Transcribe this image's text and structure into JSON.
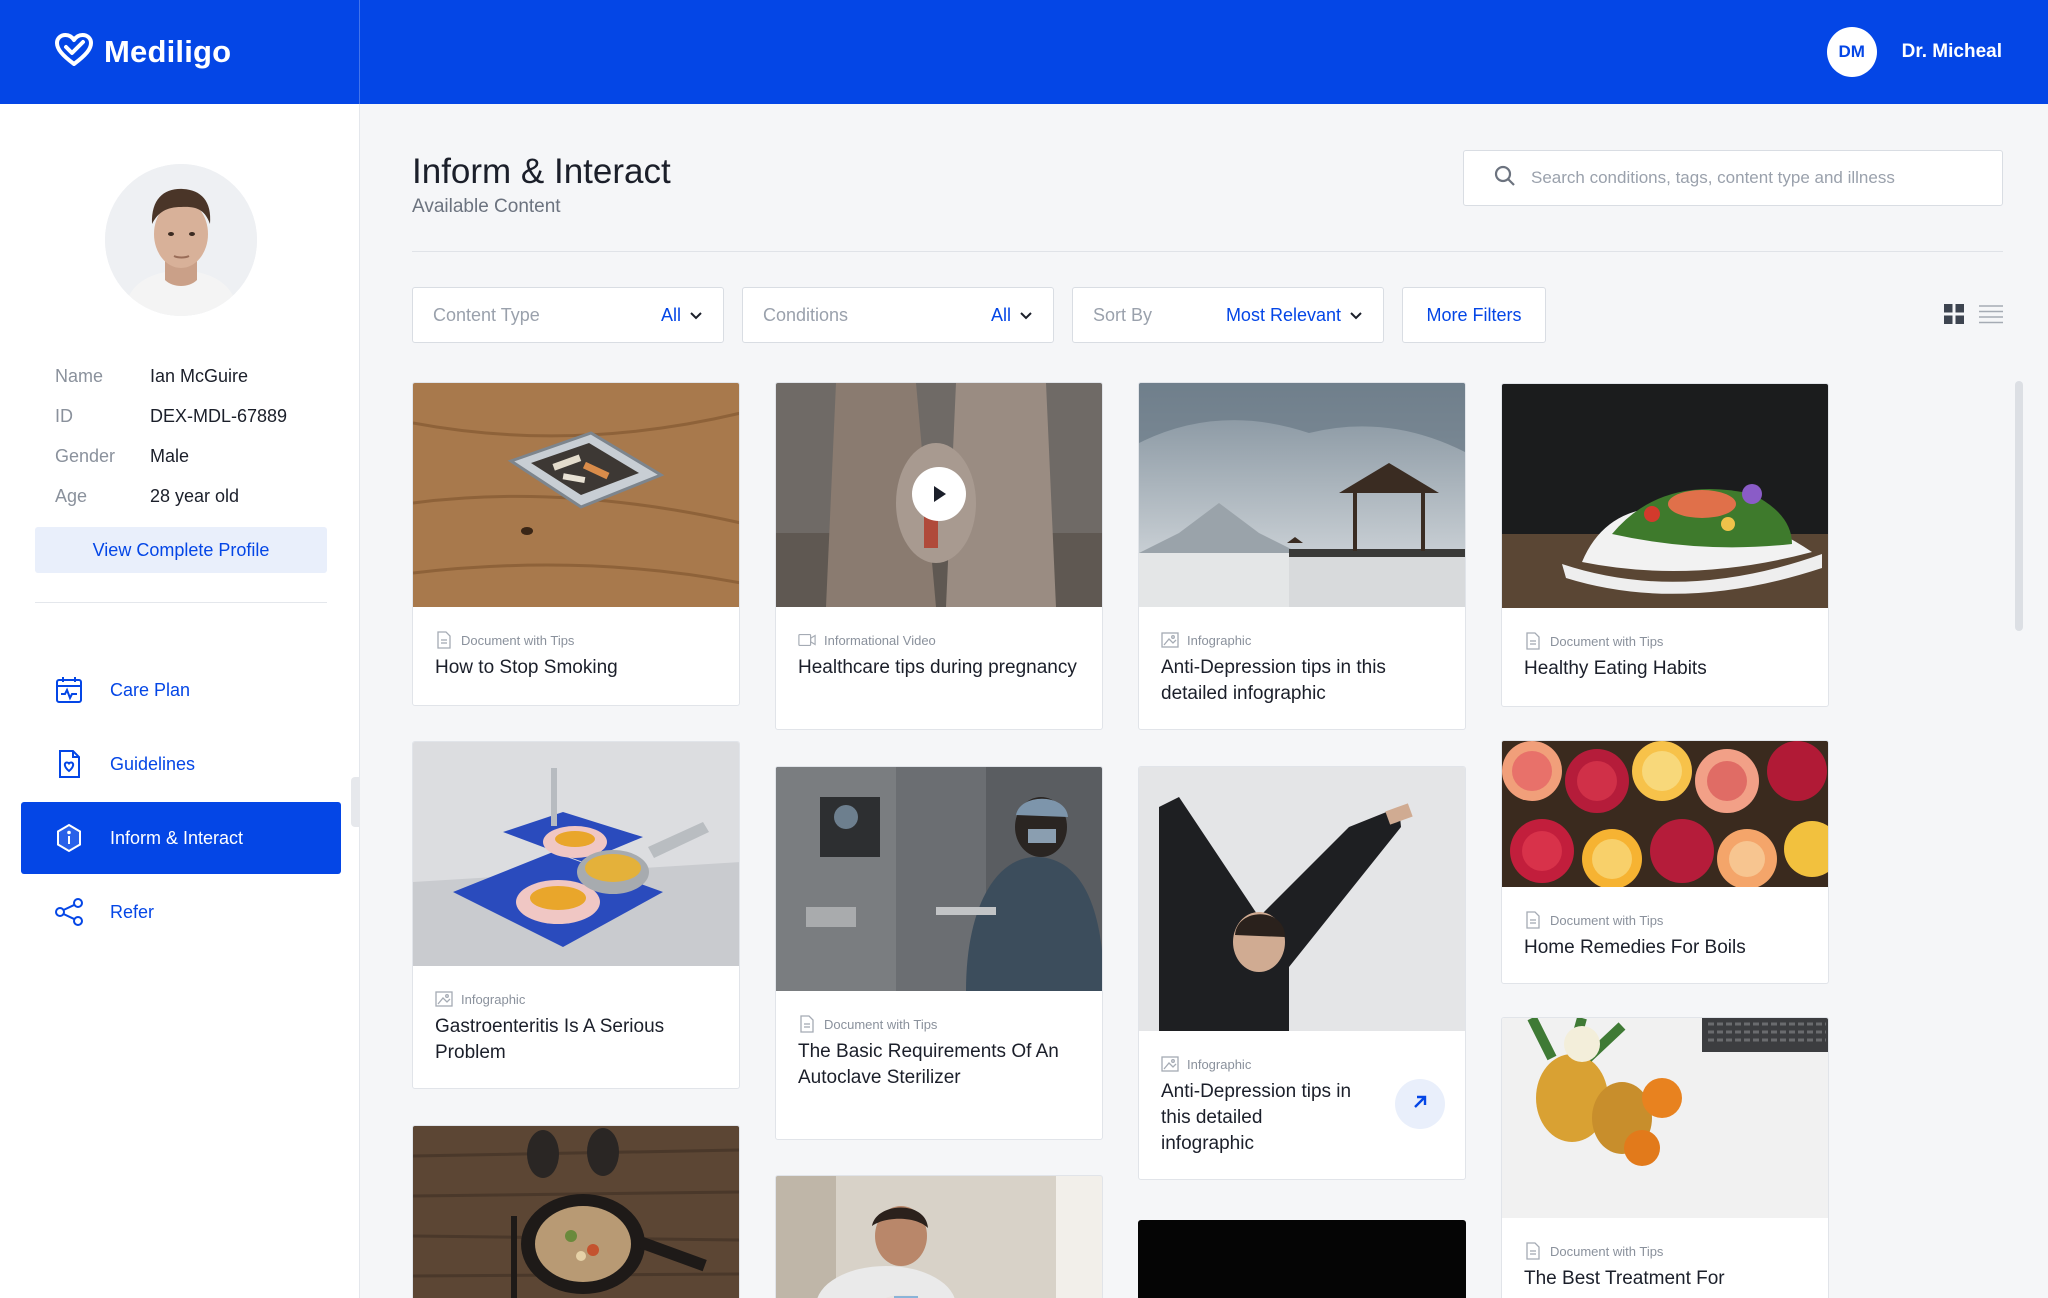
{
  "app": {
    "name": "Mediligo"
  },
  "user": {
    "initials": "DM",
    "name": "Dr. Micheal"
  },
  "patient": {
    "fields": [
      {
        "label": "Name",
        "value": "Ian McGuire"
      },
      {
        "label": "ID",
        "value": "DEX-MDL-67889"
      },
      {
        "label": "Gender",
        "value": "Male"
      },
      {
        "label": "Age",
        "value": "28 year old"
      }
    ],
    "view_profile_label": "View Complete Profile"
  },
  "nav": {
    "items": [
      {
        "label": "Care Plan",
        "icon": "calendar-icon",
        "active": false
      },
      {
        "label": "Guidelines",
        "icon": "document-heart-icon",
        "active": false
      },
      {
        "label": "Inform & Interact",
        "icon": "hexagon-info-icon",
        "active": true
      },
      {
        "label": "Refer",
        "icon": "share-icon",
        "active": false
      }
    ]
  },
  "page": {
    "title": "Inform & Interact",
    "subtitle": "Available Content",
    "search_placeholder": "Search conditions, tags, content type and illness"
  },
  "filters": {
    "content_type": {
      "label": "Content Type",
      "value": "All"
    },
    "conditions": {
      "label": "Conditions",
      "value": "All"
    },
    "sort_by": {
      "label": "Sort By",
      "value": "Most Relevant"
    },
    "more_filters_label": "More Filters"
  },
  "colors": {
    "brand": "#0446e6",
    "accent_light": "#e9effb"
  },
  "cards": [
    {
      "type": "Document with Tips",
      "icon": "document-icon",
      "title": "How to Stop Smoking"
    },
    {
      "type": "Informational Video",
      "icon": "video-icon",
      "title": "Healthcare tips during pregnancy"
    },
    {
      "type": "Infographic",
      "icon": "image-icon",
      "title": "Anti-Depression tips in this detailed infographic"
    },
    {
      "type": "Document with Tips",
      "icon": "document-icon",
      "title": "Healthy Eating Habits"
    },
    {
      "type": "Infographic",
      "icon": "image-icon",
      "title": "Gastroenteritis Is A Serious Problem"
    },
    {
      "type": "Document with Tips",
      "icon": "document-icon",
      "title": "The Basic Requirements Of An Autoclave Sterilizer"
    },
    {
      "type": "Infographic",
      "icon": "image-icon",
      "title": "Anti-Depression tips in this detailed infographic"
    },
    {
      "type": "Document with Tips",
      "icon": "document-icon",
      "title": "Home Remedies For Boils"
    },
    {
      "type": "Document with Tips",
      "icon": "document-icon",
      "title": "The Best Treatment For"
    }
  ]
}
